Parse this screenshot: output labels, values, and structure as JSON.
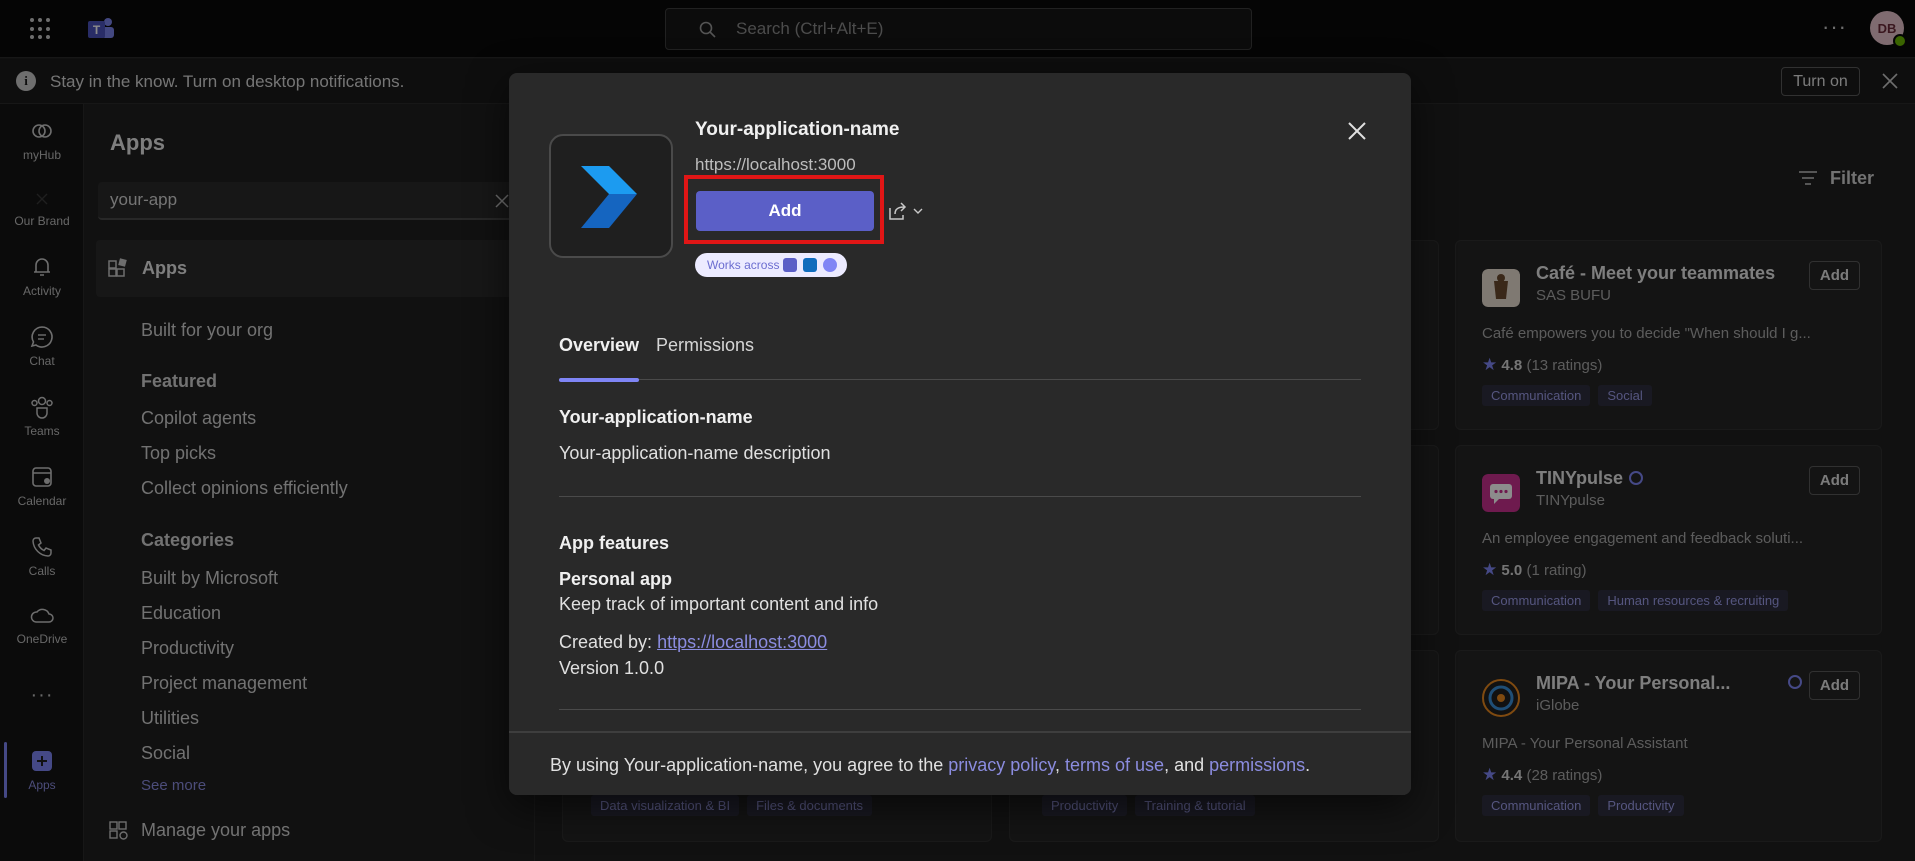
{
  "topbar": {
    "search_placeholder": "Search (Ctrl+Alt+E)",
    "more_label": "···",
    "avatar_initials": "DB"
  },
  "notification": {
    "text": "Stay in the know. Turn on desktop notifications.",
    "turn_on_label": "Turn on"
  },
  "rail": {
    "items": [
      {
        "label": "myHub",
        "icon": "myhub-icon"
      },
      {
        "label": "Our Brand",
        "icon": "our-brand-icon"
      },
      {
        "label": "Activity",
        "icon": "bell-icon"
      },
      {
        "label": "Chat",
        "icon": "chat-icon"
      },
      {
        "label": "Teams",
        "icon": "teams-icon"
      },
      {
        "label": "Calendar",
        "icon": "calendar-icon"
      },
      {
        "label": "Calls",
        "icon": "phone-icon"
      },
      {
        "label": "OneDrive",
        "icon": "cloud-icon"
      },
      {
        "label": "···",
        "icon": "more-icon"
      },
      {
        "label": "Apps",
        "icon": "apps-plus-icon"
      }
    ]
  },
  "apps_panel": {
    "title": "Apps",
    "search_value": "your-app",
    "active_nav": "Apps",
    "built_for_org": "Built for your org",
    "featured_heading": "Featured",
    "featured": [
      "Copilot agents",
      "Top picks",
      "Collect opinions efficiently"
    ],
    "categories_heading": "Categories",
    "categories": [
      "Built by Microsoft",
      "Education",
      "Productivity",
      "Project management",
      "Utilities",
      "Social"
    ],
    "see_more": "See more",
    "manage_apps": "Manage your apps"
  },
  "background": {
    "filter_label": "Filter",
    "cards": [
      {
        "name": "Café - Meet your teammates",
        "publisher": "SAS BUFU",
        "add": "Add",
        "description": "Café empowers you to decide \"When should I g...",
        "rating_value": "4.8",
        "rating_count": "(13 ratings)",
        "tags": [
          "Communication",
          "Social"
        ]
      },
      {
        "name": "TINYpulse",
        "publisher": "TINYpulse",
        "add": "Add",
        "description": "An employee engagement and feedback soluti...",
        "rating_value": "5.0",
        "rating_count": "(1 rating)",
        "tags": [
          "Communication",
          "Human resources & recruiting"
        ]
      },
      {
        "name": "MIPA - Your Personal...",
        "publisher": "iGlobe",
        "add": "Add",
        "description": "MIPA - Your Personal Assistant",
        "rating_value": "4.4",
        "rating_count": "(28 ratings)",
        "tags": [
          "Communication",
          "Productivity"
        ]
      }
    ],
    "bottom_tags_left": [
      "Data visualization & BI",
      "Files & documents"
    ],
    "bottom_tags_mid": [
      "Productivity",
      "Training & tutorial"
    ]
  },
  "modal": {
    "app_name": "Your-application-name",
    "app_url": "https://localhost:3000",
    "add_label": "Add",
    "works_across": "Works across",
    "tabs": [
      "Overview",
      "Permissions"
    ],
    "overview_title": "Your-application-name",
    "overview_description": "Your-application-name description",
    "features_heading": "App features",
    "feature_title": "Personal app",
    "feature_text": "Keep track of important content and info",
    "created_by_label": "Created by:",
    "created_by_link": "https://localhost:3000",
    "version": "Version 1.0.0",
    "footer": {
      "prefix": "By using Your-application-name, you agree to the",
      "privacy": "privacy policy",
      "comma": ",",
      "terms": "terms of use",
      "and": ", and",
      "permissions": "permissions",
      "period": "."
    }
  },
  "colors": {
    "accent": "#5b5fc7",
    "highlight": "#e01616",
    "link": "#8b8cdf"
  }
}
